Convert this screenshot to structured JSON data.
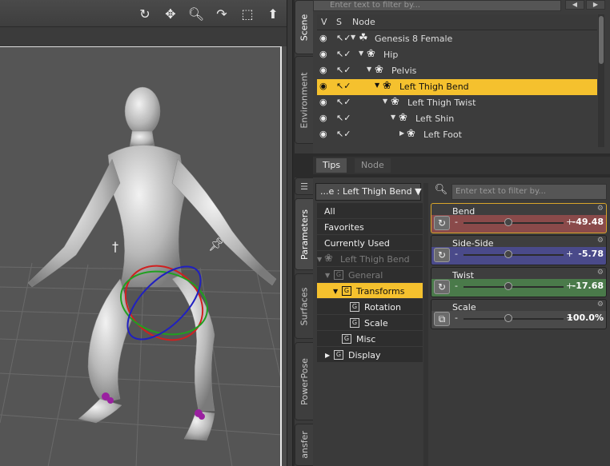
{
  "viewport": {
    "tools": [
      "orbit-icon",
      "pan-icon",
      "zoom-icon",
      "roll-icon",
      "frame-icon",
      "home-icon"
    ],
    "colors": {
      "background": "#555555",
      "rotate_x": "#d02020",
      "rotate_y": "#20a020",
      "rotate_z": "#2020c0"
    }
  },
  "side_tabs_left": [
    "Scene",
    "Environment",
    "Parameters",
    "Surfaces",
    "PowerPose",
    "ansfer"
  ],
  "scene": {
    "search_placeholder": "Enter text to filter by...",
    "columns": {
      "v": "V",
      "s": "S",
      "node": "Node"
    },
    "rows": [
      {
        "label": "Genesis 8 Female"
      },
      {
        "label": "Hip"
      },
      {
        "label": "Pelvis"
      },
      {
        "label": "Left Thigh Bend"
      },
      {
        "label": "Left Thigh Twist"
      },
      {
        "label": "Left Shin"
      },
      {
        "label": "Left Foot"
      }
    ]
  },
  "tabs": {
    "tips": "Tips",
    "node": "Node"
  },
  "params": {
    "dropdown": "...e : Left Thigh Bend",
    "search_placeholder": "Enter text to filter by...",
    "tree": {
      "all": "All",
      "favorites": "Favorites",
      "currently_used": "Currently Used",
      "node": "Left Thigh Bend",
      "general": "General",
      "transforms": "Transforms",
      "rotation": "Rotation",
      "scale": "Scale",
      "misc": "Misc",
      "display": "Display"
    },
    "sliders": [
      {
        "name": "Bend",
        "value": "-49.48",
        "fraction": 0.45,
        "color": "#8a4a4a"
      },
      {
        "name": "Side-Side",
        "value": "-5.78",
        "fraction": 0.45,
        "color": "#4a4a8a"
      },
      {
        "name": "Twist",
        "value": "-17.68",
        "fraction": 0.45,
        "color": "#4a7a4a"
      },
      {
        "name": "Scale",
        "value": "100.0%",
        "fraction": 0.45,
        "color": "#4a4a4a"
      }
    ]
  }
}
